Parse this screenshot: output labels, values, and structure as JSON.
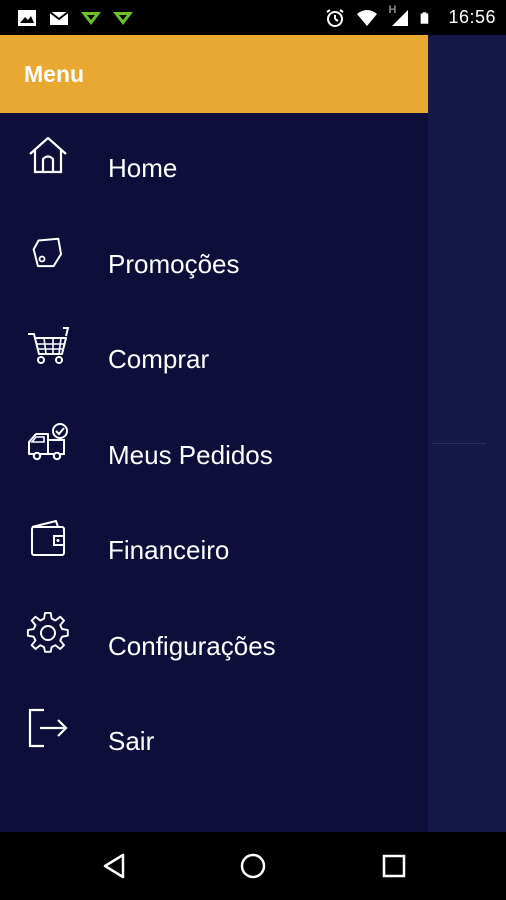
{
  "status_bar": {
    "time": "16:56",
    "network_type": "H",
    "left_icons": [
      "image-icon",
      "gmail-icon",
      "download-arrow-icon",
      "download-arrow-icon"
    ],
    "right_icons": [
      "alarm-icon",
      "wifi-icon",
      "signal-icon",
      "battery-icon"
    ]
  },
  "drawer": {
    "title": "Menu",
    "header_color": "#e8a832",
    "background_color": "#0d0e3a",
    "items": [
      {
        "label": "Home",
        "icon": "home-icon"
      },
      {
        "label": "Promoções",
        "icon": "tag-icon"
      },
      {
        "label": "Comprar",
        "icon": "cart-icon"
      },
      {
        "label": "Meus Pedidos",
        "icon": "delivery-truck-icon"
      },
      {
        "label": "Financeiro",
        "icon": "wallet-icon"
      },
      {
        "label": "Configurações",
        "icon": "gear-icon"
      },
      {
        "label": "Sair",
        "icon": "logout-icon"
      }
    ]
  },
  "nav_bar": {
    "buttons": [
      "back-icon",
      "home-circle-icon",
      "recents-square-icon"
    ]
  }
}
